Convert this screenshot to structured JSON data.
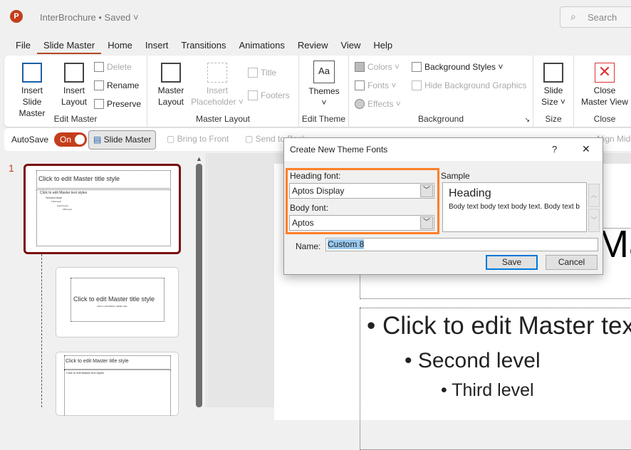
{
  "app": {
    "title": "InterBrochure",
    "status": "Saved",
    "search_placeholder": "Search",
    "logo_letter": "P"
  },
  "tabs": [
    "File",
    "Slide Master",
    "Home",
    "Insert",
    "Transitions",
    "Animations",
    "Review",
    "View",
    "Help"
  ],
  "active_tab": "Slide Master",
  "ribbon": {
    "edit_master": {
      "label": "Edit Master",
      "insert_slide_master": [
        "Insert Slide",
        "Master"
      ],
      "insert_layout": [
        "Insert",
        "Layout"
      ],
      "delete": "Delete",
      "rename": "Rename",
      "preserve": "Preserve"
    },
    "master_layout": {
      "label": "Master Layout",
      "master_layout": [
        "Master",
        "Layout"
      ],
      "insert_placeholder": [
        "Insert",
        "Placeholder ˅"
      ],
      "title": "Title",
      "footers": "Footers"
    },
    "edit_theme": {
      "label": "Edit Theme",
      "themes": "Themes"
    },
    "background": {
      "label": "Background",
      "colors": "Colors ˅",
      "fonts": "Fonts ˅",
      "effects": "Effects ˅",
      "background_styles": "Background Styles ˅",
      "hide_graphics": "Hide Background Graphics"
    },
    "size": {
      "label": "Size",
      "slide_size": [
        "Slide",
        "Size ˅"
      ]
    },
    "close": {
      "label": "Close",
      "close_master_view": [
        "Close",
        "Master View"
      ]
    }
  },
  "quickbar": {
    "autosave": "AutoSave",
    "toggle": "On",
    "slide_master": "Slide Master",
    "bring_to_front": "Bring to Front",
    "send_to_back": "Send to Back",
    "align_middle": "Align Middle"
  },
  "thumbnails": {
    "number": "1",
    "master_title": "Click to edit Master title style",
    "master_text": "Click to edit Master text styles",
    "levels": [
      "Second level",
      "Third level",
      "Fourth level",
      "Fifth level"
    ],
    "subtitle": "Click to edit Master subtitle style"
  },
  "slide": {
    "title_partial": "Ma",
    "bullets": [
      "Click to edit Master text styles",
      "Second level",
      "Third level"
    ]
  },
  "dialog": {
    "title": "Create New Theme Fonts",
    "help": "?",
    "close": "✕",
    "heading_label": "Heading font:",
    "heading_value": "Aptos Display",
    "body_label": "Body font:",
    "body_value": "Aptos",
    "sample_label": "Sample",
    "sample_heading": "Heading",
    "sample_body": "Body text body text body text. Body text body text.",
    "name_label": "Name:",
    "name_value": "Custom 8",
    "save": "Save",
    "cancel": "Cancel"
  },
  "colors": {
    "accent": "#c43e1c",
    "highlight": "#ff7f27",
    "selection": "#7b0c0c"
  }
}
